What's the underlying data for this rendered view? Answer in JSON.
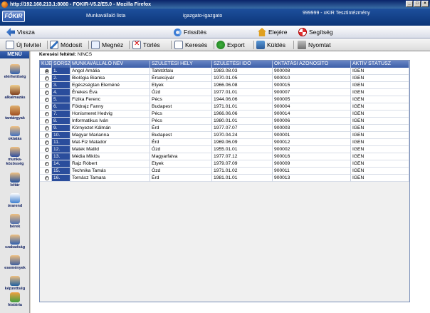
{
  "browser": {
    "title": "http://192.168.213.1:8080 - FOKIR-V5.2/E5.0 - Mozilla Firefox",
    "win_buttons": [
      "_",
      "□",
      "×"
    ]
  },
  "app": {
    "logo": "FŐKIR",
    "tab_name": "Munkavállaló lista",
    "user": "igazgato-igazgato",
    "school": "999999 - xKIR Tesztintézmény"
  },
  "toolbar_top": {
    "back": "Vissza",
    "refresh": "Frissítés",
    "home": "Elejére",
    "help": "Segítség"
  },
  "toolbar_actions": {
    "new": "Új felvitel",
    "edit": "Módosít",
    "view": "Megnéz",
    "delete": "Törlés",
    "search": "Keresés",
    "export": "Export",
    "send": "Küldés",
    "print": "Nyomtat"
  },
  "menu": {
    "title": "MENÜ",
    "items": [
      "elérhetőség",
      "alkalmazás",
      "tantárgyak",
      "oktatás",
      "munka-közösség",
      "leltár",
      "órarend",
      "bérek",
      "szabadság",
      "események",
      "képzettség",
      "história"
    ]
  },
  "criteria": {
    "label": "Keresési feltétel:",
    "value": "NINCS"
  },
  "table": {
    "headers": [
      "KIJEL",
      "SORSZ",
      "MUNKAVÁLLALÓ NÉV",
      "SZÜLETÉSI HELY",
      "SZÜLETÉSI IDŐ",
      "OKTATÁSI AZONOSÍTÓ",
      "AKTÍV STÁTUSZ"
    ],
    "rows": [
      {
        "nr": "1.",
        "name": "Angol Amália",
        "place": "Tahitótfalu",
        "date": "1983.08.03",
        "id": "900008",
        "status": "IGEN",
        "selected": true
      },
      {
        "nr": "2.",
        "name": "Biológia Bianka",
        "place": "Érsekújvár",
        "date": "1970.01.05",
        "id": "900010",
        "status": "IGEN",
        "selected": false
      },
      {
        "nr": "3.",
        "name": "Egészségtan Eleméné",
        "place": "Etyek",
        "date": "1966.06.08",
        "id": "900015",
        "status": "IGEN",
        "selected": false
      },
      {
        "nr": "4.",
        "name": "Énekes Éva",
        "place": "Ózd",
        "date": "1977.01.01",
        "id": "900007",
        "status": "IGEN",
        "selected": false
      },
      {
        "nr": "5.",
        "name": "Fizika Ferenc",
        "place": "Pécs",
        "date": "1944.06.06",
        "id": "900005",
        "status": "IGEN",
        "selected": false
      },
      {
        "nr": "6.",
        "name": "Földrajz Fanny",
        "place": "Budapest",
        "date": "1971.01.01",
        "id": "900004",
        "status": "IGEN",
        "selected": false
      },
      {
        "nr": "7.",
        "name": "Honismeret Hedvig",
        "place": "Pécs",
        "date": "1966.06.06",
        "id": "900014",
        "status": "IGEN",
        "selected": false
      },
      {
        "nr": "8.",
        "name": "Informatikus Iván",
        "place": "Pécs",
        "date": "1980.01.01",
        "id": "900006",
        "status": "IGEN",
        "selected": false
      },
      {
        "nr": "9.",
        "name": "Környezet Kálmán",
        "place": "Érd",
        "date": "1977.07.07",
        "id": "900003",
        "status": "IGEN",
        "selected": false
      },
      {
        "nr": "10.",
        "name": "Magyar Marianna",
        "place": "Budapest",
        "date": "1970.04.24",
        "id": "900001",
        "status": "IGEN",
        "selected": false
      },
      {
        "nr": "11.",
        "name": "Mat-Fiz Matador",
        "place": "Érd",
        "date": "1969.06.09",
        "id": "900012",
        "status": "IGEN",
        "selected": false
      },
      {
        "nr": "12.",
        "name": "Matek Matild",
        "place": "Ózd",
        "date": "1955.01.01",
        "id": "900002",
        "status": "IGEN",
        "selected": false
      },
      {
        "nr": "13.",
        "name": "Média Miklós",
        "place": "Magyarfalva",
        "date": "1977.07.12",
        "id": "900016",
        "status": "IGEN",
        "selected": false
      },
      {
        "nr": "14.",
        "name": "Rajz Róbert",
        "place": "Etyek",
        "date": "1979.07.09",
        "id": "900009",
        "status": "IGEN",
        "selected": false
      },
      {
        "nr": "15.",
        "name": "Technika Tamás",
        "place": "Ózd",
        "date": "1971.01.02",
        "id": "900011",
        "status": "IGEN",
        "selected": false
      },
      {
        "nr": "16.",
        "name": "Tornász Tamara",
        "place": "Érd",
        "date": "1981.01.01",
        "id": "900013",
        "status": "IGEN",
        "selected": false
      }
    ]
  }
}
